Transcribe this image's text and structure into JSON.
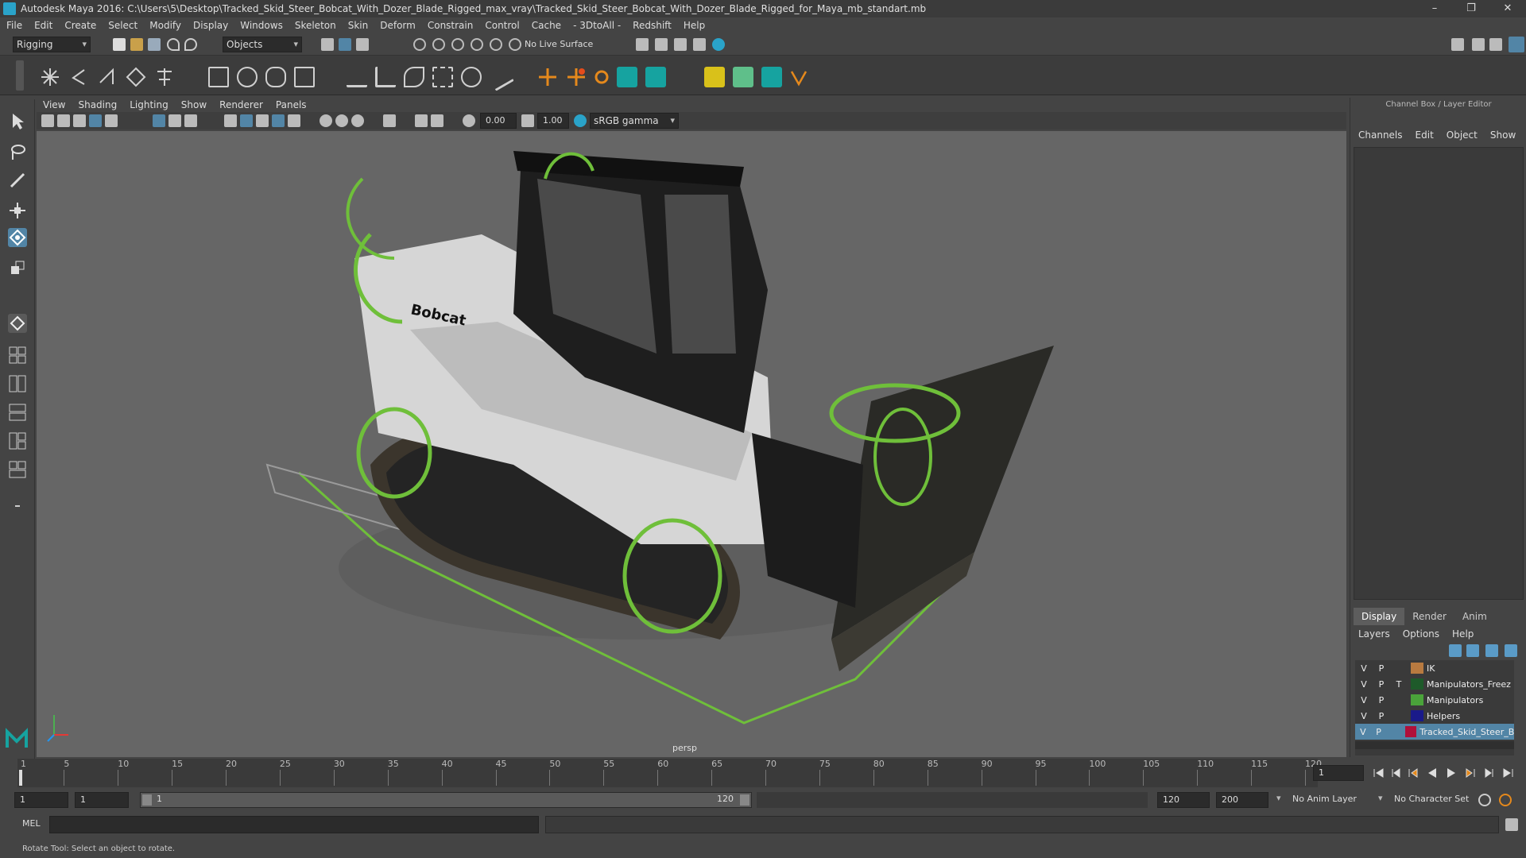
{
  "window": {
    "title": "Autodesk Maya 2016: C:\\Users\\5\\Desktop\\Tracked_Skid_Steer_Bobcat_With_Dozer_Blade_Rigged_max_vray\\Tracked_Skid_Steer_Bobcat_With_Dozer_Blade_Rigged_for_Maya_mb_standart.mb",
    "min": "–",
    "max": "❐",
    "close": "✕"
  },
  "menubar": [
    "File",
    "Edit",
    "Create",
    "Select",
    "Modify",
    "Display",
    "Windows",
    "Skeleton",
    "Skin",
    "Deform",
    "Constrain",
    "Control",
    "Cache",
    "- 3DtoAll -",
    "Redshift",
    "Help"
  ],
  "statusline": {
    "menuset": "Rigging",
    "selection_mode": "Objects",
    "live_surface": "No Live Surface"
  },
  "viewport": {
    "menu": [
      "View",
      "Shading",
      "Lighting",
      "Show",
      "Renderer",
      "Panels"
    ],
    "field_a": "0.00",
    "field_b": "1.00",
    "color_space": "sRGB gamma",
    "camera": "persp",
    "logo_text": "Bobcat"
  },
  "right_panel": {
    "title": "Channel Box / Layer Editor",
    "menu": [
      "Channels",
      "Edit",
      "Object",
      "Show"
    ],
    "tabs": [
      "Display",
      "Render",
      "Anim"
    ],
    "layer_menu": [
      "Layers",
      "Options",
      "Help"
    ],
    "layers": [
      {
        "v": "V",
        "p": "P",
        "t": "",
        "color": "#b87a40",
        "name": "IK"
      },
      {
        "v": "V",
        "p": "P",
        "t": "T",
        "color": "#1e5a2a",
        "name": "Manipulators_Freez"
      },
      {
        "v": "V",
        "p": "P",
        "t": "",
        "color": "#4aa33a",
        "name": "Manipulators"
      },
      {
        "v": "V",
        "p": "P",
        "t": "",
        "color": "#1a1a8a",
        "name": "Helpers"
      },
      {
        "v": "V",
        "p": "P",
        "t": "",
        "color": "#b0103a",
        "name": "Tracked_Skid_Steer_Bob"
      }
    ]
  },
  "timeline": {
    "ticks": [
      "1",
      "5",
      "10",
      "15",
      "20",
      "25",
      "30",
      "35",
      "40",
      "45",
      "50",
      "55",
      "60",
      "65",
      "70",
      "75",
      "80",
      "85",
      "90",
      "95",
      "100",
      "105",
      "110",
      "115",
      "120"
    ],
    "current_frame": "1"
  },
  "range": {
    "start": "1",
    "playback_start": "1",
    "slider_start": "1",
    "slider_end": "120",
    "playback_end": "120",
    "end": "200",
    "anim_layer": "No Anim Layer",
    "character_set": "No Character Set"
  },
  "cmdline": {
    "label": "MEL"
  },
  "helpline": {
    "text": "Rotate Tool: Select an object to rotate."
  },
  "colors": {
    "accent": "#5285a6",
    "manip_green": "#6fbf3a"
  }
}
